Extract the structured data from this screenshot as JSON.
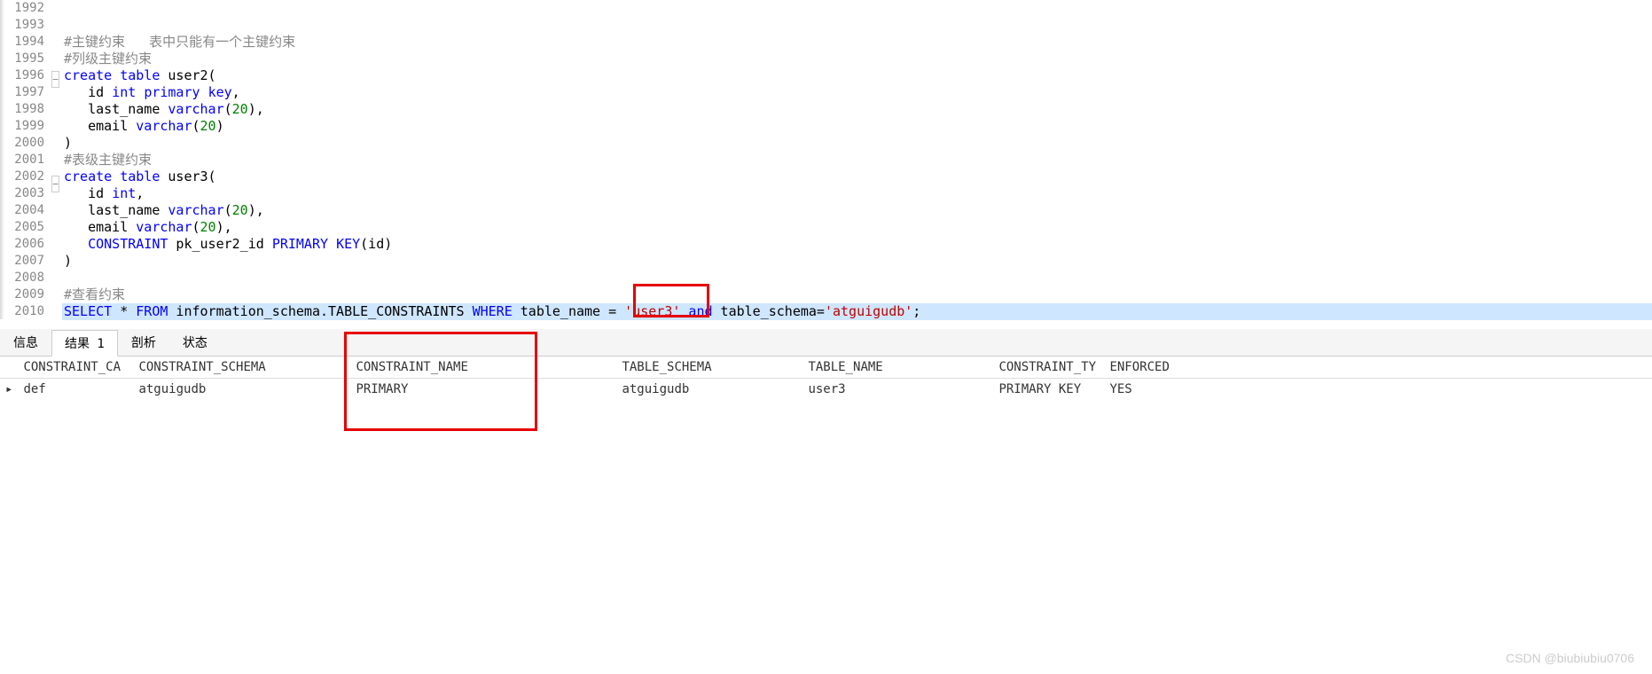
{
  "editor": {
    "lines": [
      {
        "num": "1992",
        "fold": "",
        "tokens": []
      },
      {
        "num": "1993",
        "fold": "",
        "tokens": []
      },
      {
        "num": "1994",
        "fold": "",
        "tokens": [
          {
            "t": "#主键约束   表中只能有一个主键约束",
            "c": "cmt"
          }
        ]
      },
      {
        "num": "1995",
        "fold": "",
        "tokens": [
          {
            "t": "#列级主键约束",
            "c": "cmt"
          }
        ]
      },
      {
        "num": "1996",
        "fold": "⊟",
        "tokens": [
          {
            "t": "create",
            "c": "kw"
          },
          {
            "t": " ",
            "c": ""
          },
          {
            "t": "table",
            "c": "kw"
          },
          {
            "t": " user2(",
            "c": "ident"
          }
        ]
      },
      {
        "num": "1997",
        "fold": "",
        "tokens": [
          {
            "t": "   id ",
            "c": "ident"
          },
          {
            "t": "int",
            "c": "type"
          },
          {
            "t": " ",
            "c": ""
          },
          {
            "t": "primary",
            "c": "kw"
          },
          {
            "t": " ",
            "c": ""
          },
          {
            "t": "key",
            "c": "kw"
          },
          {
            "t": ",",
            "c": "ident"
          }
        ]
      },
      {
        "num": "1998",
        "fold": "",
        "tokens": [
          {
            "t": "   last_name ",
            "c": "ident"
          },
          {
            "t": "varchar",
            "c": "type"
          },
          {
            "t": "(",
            "c": "ident"
          },
          {
            "t": "20",
            "c": "num"
          },
          {
            "t": "),",
            "c": "ident"
          }
        ]
      },
      {
        "num": "1999",
        "fold": "",
        "tokens": [
          {
            "t": "   email ",
            "c": "ident"
          },
          {
            "t": "varchar",
            "c": "type"
          },
          {
            "t": "(",
            "c": "ident"
          },
          {
            "t": "20",
            "c": "num"
          },
          {
            "t": ")",
            "c": "ident"
          }
        ]
      },
      {
        "num": "2000",
        "fold": "",
        "tokens": [
          {
            "t": ")",
            "c": "ident"
          }
        ]
      },
      {
        "num": "2001",
        "fold": "",
        "tokens": [
          {
            "t": "#表级主键约束",
            "c": "cmt"
          }
        ]
      },
      {
        "num": "2002",
        "fold": "⊟",
        "tokens": [
          {
            "t": "create",
            "c": "kw"
          },
          {
            "t": " ",
            "c": ""
          },
          {
            "t": "table",
            "c": "kw"
          },
          {
            "t": " user3(",
            "c": "ident"
          }
        ]
      },
      {
        "num": "2003",
        "fold": "",
        "tokens": [
          {
            "t": "   id ",
            "c": "ident"
          },
          {
            "t": "int",
            "c": "type"
          },
          {
            "t": ",",
            "c": "ident"
          }
        ]
      },
      {
        "num": "2004",
        "fold": "",
        "tokens": [
          {
            "t": "   last_name ",
            "c": "ident"
          },
          {
            "t": "varchar",
            "c": "type"
          },
          {
            "t": "(",
            "c": "ident"
          },
          {
            "t": "20",
            "c": "num"
          },
          {
            "t": "),",
            "c": "ident"
          }
        ]
      },
      {
        "num": "2005",
        "fold": "",
        "tokens": [
          {
            "t": "   email ",
            "c": "ident"
          },
          {
            "t": "varchar",
            "c": "type"
          },
          {
            "t": "(",
            "c": "ident"
          },
          {
            "t": "20",
            "c": "num"
          },
          {
            "t": "),",
            "c": "ident"
          }
        ]
      },
      {
        "num": "2006",
        "fold": "",
        "tokens": [
          {
            "t": "   ",
            "c": ""
          },
          {
            "t": "CONSTRAINT",
            "c": "kw"
          },
          {
            "t": " pk_user2_id ",
            "c": "ident"
          },
          {
            "t": "PRIMARY",
            "c": "kw"
          },
          {
            "t": " ",
            "c": ""
          },
          {
            "t": "KEY",
            "c": "kw"
          },
          {
            "t": "(id)",
            "c": "ident"
          }
        ]
      },
      {
        "num": "2007",
        "fold": "",
        "tokens": [
          {
            "t": ")",
            "c": "ident"
          }
        ]
      },
      {
        "num": "2008",
        "fold": "",
        "tokens": []
      },
      {
        "num": "2009",
        "fold": "",
        "tokens": [
          {
            "t": "#查看约束",
            "c": "cmt"
          }
        ]
      },
      {
        "num": "2010",
        "fold": "",
        "hl": true,
        "tokens": [
          {
            "t": "SELECT",
            "c": "kw"
          },
          {
            "t": " * ",
            "c": "ident"
          },
          {
            "t": "FROM",
            "c": "kw"
          },
          {
            "t": " information_schema.TABLE_CONSTRAINTS ",
            "c": "ident"
          },
          {
            "t": "WHERE",
            "c": "kw"
          },
          {
            "t": " table_name =",
            "c": "ident"
          },
          {
            "t": " 'user3' ",
            "c": "str"
          },
          {
            "t": "and",
            "c": "kw"
          },
          {
            "t": " table_schema=",
            "c": "ident"
          },
          {
            "t": "'atguigudb'",
            "c": "str"
          },
          {
            "t": ";",
            "c": "ident"
          }
        ]
      }
    ]
  },
  "tabs": {
    "items": [
      {
        "label": "信息",
        "active": false
      },
      {
        "label": "结果 1",
        "active": true
      },
      {
        "label": "剖析",
        "active": false
      },
      {
        "label": "状态",
        "active": false
      }
    ]
  },
  "result": {
    "headers": [
      "CONSTRAINT_CA",
      "CONSTRAINT_SCHEMA",
      "CONSTRAINT_NAME",
      "TABLE_SCHEMA",
      "TABLE_NAME",
      "CONSTRAINT_TY",
      "ENFORCED"
    ],
    "rows": [
      {
        "indicator": "▸",
        "cells": [
          "def",
          "atguigudb",
          "PRIMARY",
          "atguigudb",
          "user3",
          "PRIMARY KEY",
          "YES"
        ]
      }
    ]
  },
  "watermark": "CSDN @biubiubiu0706"
}
